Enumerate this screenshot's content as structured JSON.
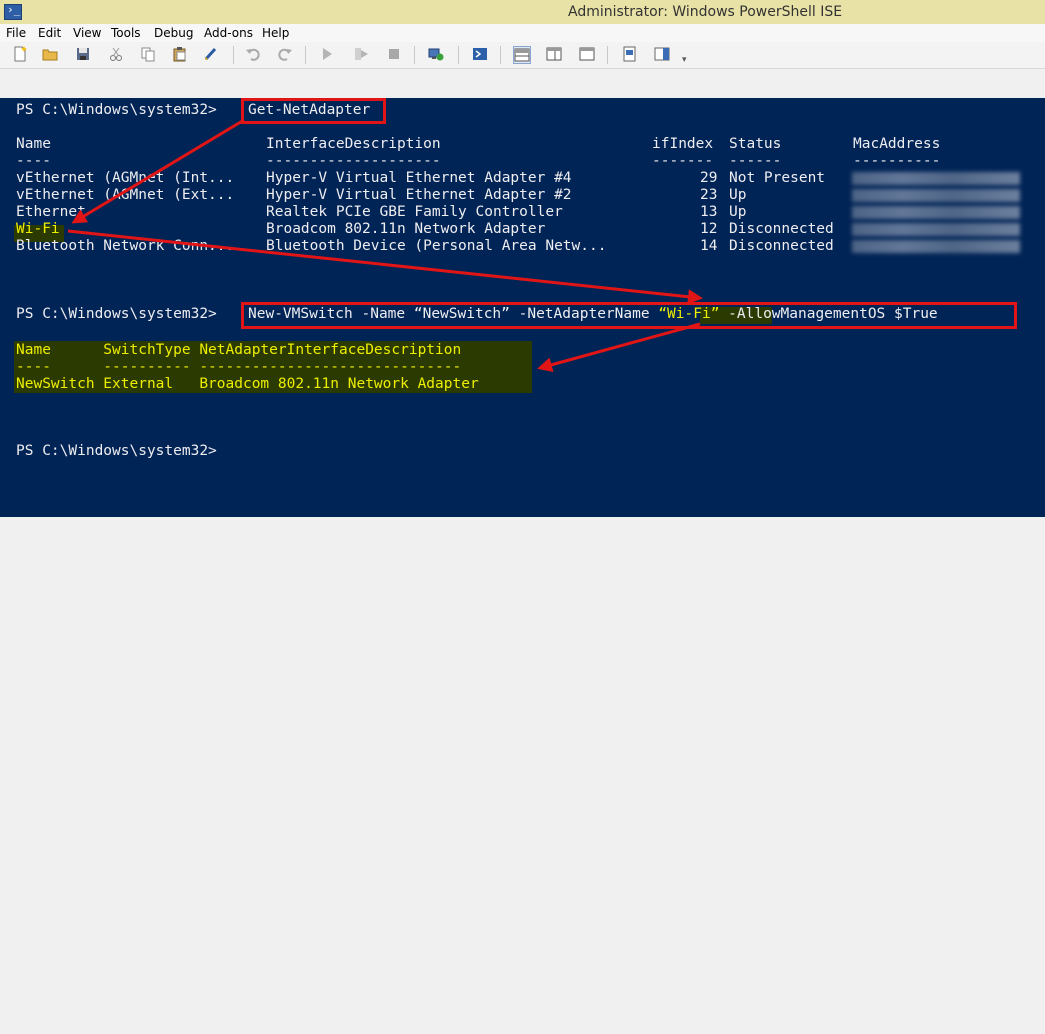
{
  "window": {
    "title": "Administrator: Windows PowerShell ISE"
  },
  "menu": [
    "File",
    "Edit",
    "View",
    "Tools",
    "Debug",
    "Add-ons",
    "Help"
  ],
  "toolbar_icons": [
    "new-file-icon",
    "open-folder-icon",
    "save-icon",
    "cut-icon",
    "copy-icon",
    "paste-icon",
    "clear-console-icon",
    "undo-icon",
    "redo-icon",
    "run-script-icon",
    "run-selection-icon",
    "stop-icon",
    "new-remote-tab-icon",
    "powershell-icon",
    "script-pane-top-icon",
    "script-pane-right-icon",
    "script-pane-maximized-icon",
    "show-command-window-icon",
    "show-command-addon-icon"
  ],
  "console": {
    "prompt1": "PS C:\\Windows\\system32>",
    "cmd1": "Get-NetAdapter",
    "table1": {
      "headers": [
        "Name",
        "InterfaceDescription",
        "ifIndex",
        "Status",
        "MacAddress"
      ],
      "dashes": [
        "----",
        "--------------------",
        "-------",
        "------",
        "----------"
      ],
      "rows": [
        [
          "vEthernet (AGMnet (Int...",
          "Hyper-V Virtual Ethernet Adapter #4",
          "29",
          "Not Present"
        ],
        [
          "vEthernet (AGMnet (Ext...",
          "Hyper-V Virtual Ethernet Adapter #2",
          "23",
          "Up"
        ],
        [
          "Ethernet",
          "Realtek PCIe GBE Family Controller",
          "13",
          "Up"
        ],
        [
          "Wi-Fi",
          "Broadcom 802.11n Network Adapter",
          "12",
          "Disconnected"
        ],
        [
          "Bluetooth Network Conn...",
          "Bluetooth Device (Personal Area Netw...",
          "14",
          "Disconnected"
        ]
      ]
    },
    "prompt2": "PS C:\\Windows\\system32>",
    "cmd2_part1": "New-VMSwitch -Name “NewSwitch” -NetAdapterName ",
    "cmd2_wifi": "“Wi-Fi”",
    "cmd2_part2": " -AllowManagementOS $True",
    "table2": {
      "header": "Name      SwitchType NetAdapterInterfaceDescription",
      "dashes": "----      ---------- ------------------------------",
      "row": "NewSwitch External   Broadcom 802.11n Network Adapter"
    },
    "prompt3": "PS C:\\Windows\\system32>"
  },
  "colors": {
    "console_bg": "#012456",
    "highlight_text": "#eeee00",
    "annotation_red": "#e11515"
  }
}
